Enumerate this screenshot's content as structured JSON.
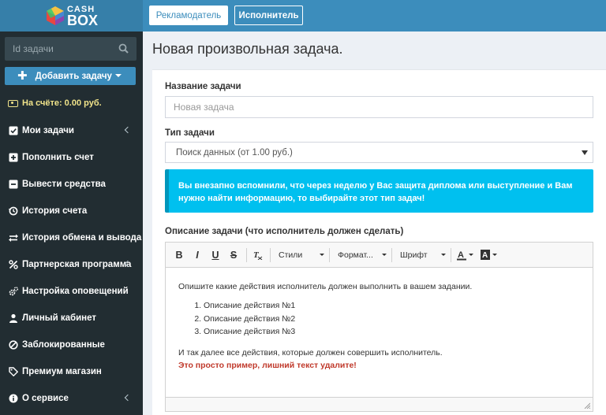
{
  "brand": {
    "cash": "CASH",
    "box": "BOX"
  },
  "search": {
    "placeholder": "Id задачи"
  },
  "add_task": {
    "label": "Добавить задачу"
  },
  "balance": {
    "text": "На счёте: 0.00 руб."
  },
  "menu": [
    {
      "label": "Мои задачи",
      "icon": "checkbox-icon",
      "has_chevron": true
    },
    {
      "label": "Пополнить счет",
      "icon": "plus-square-icon",
      "has_chevron": false
    },
    {
      "label": "Вывести средства",
      "icon": "minus-square-icon",
      "has_chevron": false
    },
    {
      "label": "История счета",
      "icon": "history-icon",
      "has_chevron": false
    },
    {
      "label": "История обмена и вывода",
      "icon": "exchange-icon",
      "has_chevron": false
    },
    {
      "label": "Партнерская программа",
      "icon": "percent-icon",
      "has_chevron": true
    },
    {
      "label": "Настройка оповещений",
      "icon": "gears-icon",
      "has_chevron": false
    },
    {
      "label": "Личный кабинет",
      "icon": "user-icon",
      "has_chevron": false
    },
    {
      "label": "Заблокированные",
      "icon": "ban-icon",
      "has_chevron": false
    },
    {
      "label": "Премиум магазин",
      "icon": "tag-icon",
      "has_chevron": false
    },
    {
      "label": "О сервисе",
      "icon": "info-circle-icon",
      "has_chevron": true
    }
  ],
  "topbar": {
    "advertiser": "Рекламодатель",
    "executor": "Исполнитель"
  },
  "page": {
    "title": "Новая произвольная задача."
  },
  "form": {
    "name_label": "Название задачи",
    "name_placeholder": "Новая задача",
    "type_label": "Тип задачи",
    "type_value": "Поиск данных (от 1.00 руб.)",
    "info_text": "Вы внезапно вспомнили, что через неделю у Вас защита диплома или выступление и Вам нужно найти информацию, то выбирайте этот тип задач!",
    "desc_label": "Описание задачи (что исполнитель должен сделать)"
  },
  "editor": {
    "toolbar": {
      "styles": "Стили",
      "format": "Формат...",
      "font": "Шрифт"
    },
    "intro": "Опишите какие действия исполнитель должен выполнить в вашем задании.",
    "steps": [
      "Описание действия №1",
      "Описание действия №2",
      "Описание действия №3"
    ],
    "outro": "И так далее все действия, которые должен совершить исполнитель.",
    "note": "Это просто пример, лишний текст удалите!"
  }
}
